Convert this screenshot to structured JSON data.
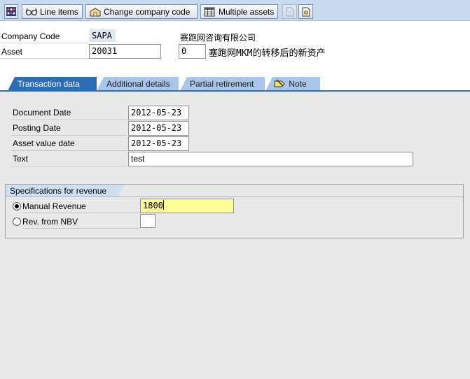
{
  "toolbar": {
    "line_items": "Line items",
    "change_company_code": "Change company code",
    "multiple_assets": "Multiple assets"
  },
  "header": {
    "company_code_label": "Company Code",
    "company_code_value": "SAPA",
    "company_name": "赛跑网咨询有限公司",
    "asset_label": "Asset",
    "asset_value": "20031",
    "asset_sub_value": "0",
    "asset_description": "塞跑网MKM的转移后的新资产"
  },
  "tabs": [
    {
      "label": "Transaction data",
      "active": true
    },
    {
      "label": "Additional details",
      "active": false
    },
    {
      "label": "Partial retirement",
      "active": false
    },
    {
      "label": "Note",
      "active": false
    }
  ],
  "transaction": {
    "document_date_label": "Document Date",
    "document_date": "2012-05-23",
    "posting_date_label": "Posting Date",
    "posting_date": "2012-05-23",
    "asset_value_date_label": "Asset value date",
    "asset_value_date": "2012-05-23",
    "text_label": "Text",
    "text_value": "test"
  },
  "revenue": {
    "group_title": "Specifications for revenue",
    "manual_revenue_label": "Manual Revenue",
    "manual_revenue_value": "1800",
    "manual_revenue_selected": true,
    "rev_from_nbv_label": "Rev. from NBV",
    "rev_from_nbv_selected": false
  },
  "colors": {
    "toolbar_bg": "#c8daf0",
    "active_tab": "#2e6db4",
    "inactive_tab": "#a9c6ea",
    "content_bg": "#e8e8e8",
    "focused_input": "#ffff99"
  }
}
